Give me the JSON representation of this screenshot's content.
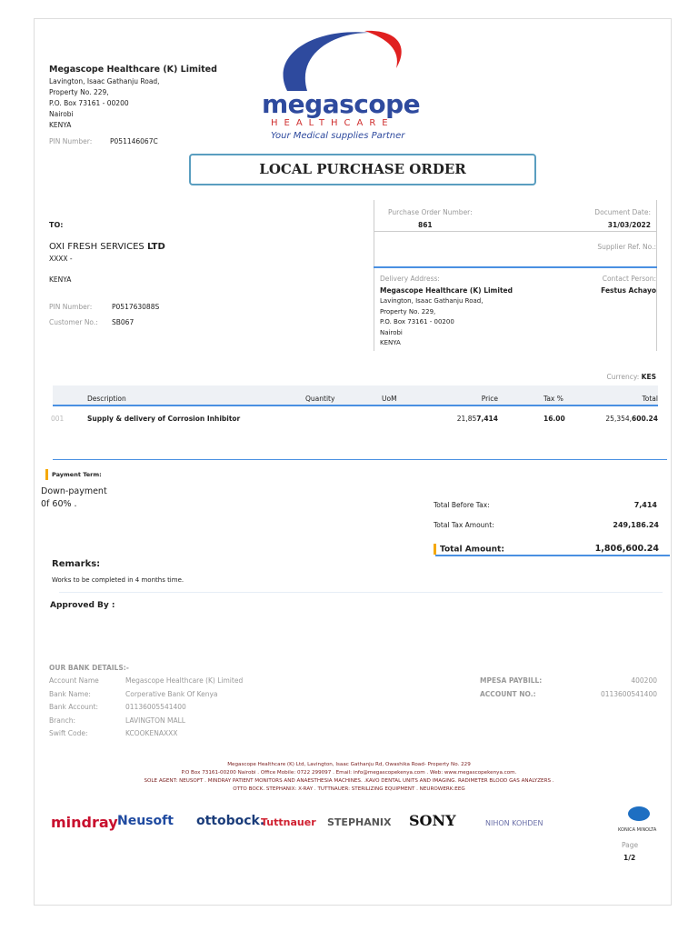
{
  "company": {
    "name": "Megascope Healthcare (K) Limited",
    "address": [
      "Lavington, Isaac Gathanju Road,",
      "Property No. 229,",
      "P.O. Box 73161 - 00200",
      "Nairobi",
      "KENYA"
    ],
    "pin_label": "PIN Number:",
    "pin": "P051146067C"
  },
  "logo": {
    "brand": "megascope",
    "sub": "HEALTHCARE",
    "tagline": "Your Medical supplies Partner"
  },
  "title": "LOCAL PURCHASE ORDER",
  "to": {
    "label": "TO:",
    "name": "OXI FRESH SERVICES",
    "name_suffix": "LTD",
    "line": "XXXX -",
    "country": "KENYA",
    "pin_label": "PIN Number:",
    "pin": "P051763088S",
    "cust_label": "Customer No.:",
    "cust": "SB067"
  },
  "order": {
    "po_label": "Purchase Order Number:",
    "po": "861",
    "date_label": "Document Date:",
    "date": "31/03/2022",
    "supplier_ref_label": "Supplier Ref. No.:",
    "delivery_label": "Delivery Address:",
    "delivery_name": "Megascope Healthcare (K) Limited",
    "delivery_lines": [
      "Lavington, Isaac Gathanju Road,",
      "Property No. 229,",
      "P.O. Box 73161 - 00200",
      "Nairobi",
      "KENYA"
    ],
    "contact_label": "Contact Person:",
    "contact": "Festus Achayo"
  },
  "currency_label": "Currency:",
  "currency": "KES",
  "table": {
    "headers": [
      "Description",
      "Quantity",
      "UoM",
      "Price",
      "Tax %",
      "Total"
    ],
    "rows": [
      {
        "no": "001",
        "description": "Supply & delivery of Corrosion Inhibitor",
        "quantity": "",
        "uom": "",
        "price_a": "21,85",
        "price_b": "7,414",
        "tax": "16.00",
        "total_a": "25,354,",
        "total_b": "600.24"
      }
    ]
  },
  "payment": {
    "label": "Payment Term:",
    "text1": "Down-payment",
    "text2": "0f 60% ."
  },
  "totals": {
    "before_label": "Total Before Tax:",
    "before": "7,414",
    "tax_label": "Total Tax Amount:",
    "tax": "249,186.24",
    "total_label": "Total Amount:",
    "total": "1,806,600.24"
  },
  "remarks": {
    "label": "Remarks:",
    "text": "Works to be completed in 4 months time."
  },
  "approved_label": "Approved By :",
  "bank": {
    "title": "OUR BANK DETAILS:-",
    "rows": [
      [
        "Account Name",
        "Megascope Healthcare (K) Limited"
      ],
      [
        "Bank Name:",
        "Corperative Bank Of Kenya"
      ],
      [
        "Bank Account:",
        "01136005541400"
      ],
      [
        "Branch:",
        "LAVINGTON MALL"
      ],
      [
        "Swift Code:",
        "KCOOKENAXXX"
      ]
    ],
    "right": [
      [
        "MPESA PAYBILL:",
        "400200"
      ],
      [
        "ACCOUNT NO.:",
        "0113600541400"
      ]
    ]
  },
  "footer": [
    "Megascope Healthcare (K) Ltd, Lavington, Isaac Gathanju Rd, Owashika Road- Property No. 229",
    "P.O Box 73161-00200 Nairobi . Office Mobile: 0722 299097 . Email: info@megascopekenya.com . Web: www.megascopekenya.com.",
    "SOLE AGENT: NEUSOFT . MINDRAY PATIENT MONITORS AND ANAESTHESIA MACHINES. .KAVO DENTAL UNITS AND IMAGING. RADIMETER BLOOD GAS ANALYZERS .",
    "OTTO BOCK. STEPHANIX: X-RAY . TUTTNAUER: STERILIZING EQUIPMENT . NEUROWERK:EEG"
  ],
  "partners": [
    "mindray",
    "Neusoft",
    "ottobock.",
    "Tuttnauer",
    "STEPHANIX",
    "SONY",
    "NIHON KOHDEN",
    "KONICA MINOLTA"
  ],
  "page": {
    "label": "Page",
    "value": "1/2"
  }
}
